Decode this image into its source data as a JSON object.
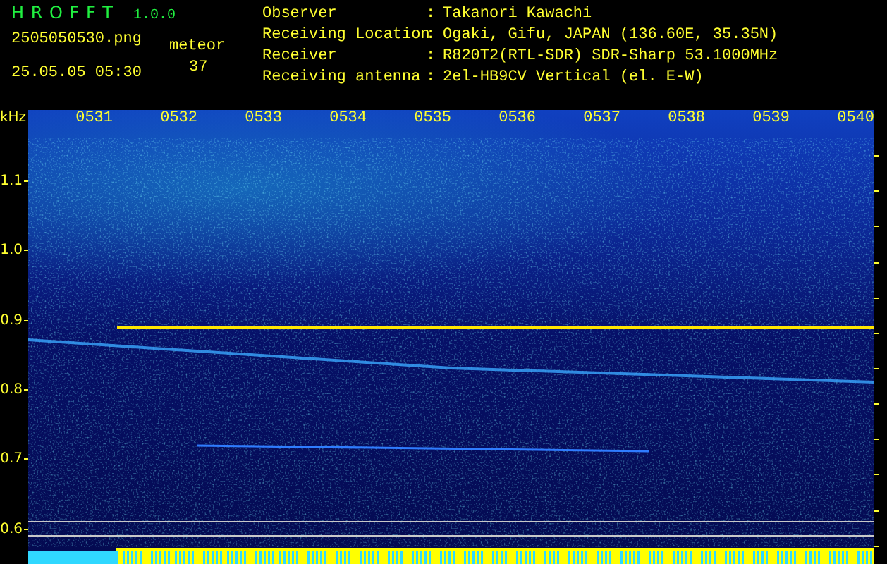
{
  "app": {
    "name": "H R O F F T",
    "version": "1.0.0"
  },
  "file": {
    "filename": "2505050530.png",
    "datetime": "25.05.05 05:30"
  },
  "meteor": {
    "label": "meteor",
    "count": "37"
  },
  "info": [
    {
      "label": "Observer",
      "separator": ":",
      "value": "Takanori Kawachi"
    },
    {
      "label": "Receiving Location",
      "separator": ":",
      "value": "Ogaki, Gifu, JAPAN (136.60E, 35.35N)"
    },
    {
      "label": "Receiver",
      "separator": ":",
      "value": "R820T2(RTL-SDR) SDR-Sharp 53.1000MHz"
    },
    {
      "label": "Receiving antenna",
      "separator": ":",
      "value": "2el-HB9CV Vertical (el. E-W)"
    }
  ],
  "y_axis": {
    "unit": "kHz",
    "labels": [
      "1.1",
      "1.0",
      "0.9",
      "0.8",
      "0.7",
      "0.6"
    ]
  },
  "time_labels": [
    "0531",
    "0532",
    "0533",
    "0534",
    "0535",
    "0536",
    "0537",
    "0538",
    "0539",
    "0540"
  ]
}
